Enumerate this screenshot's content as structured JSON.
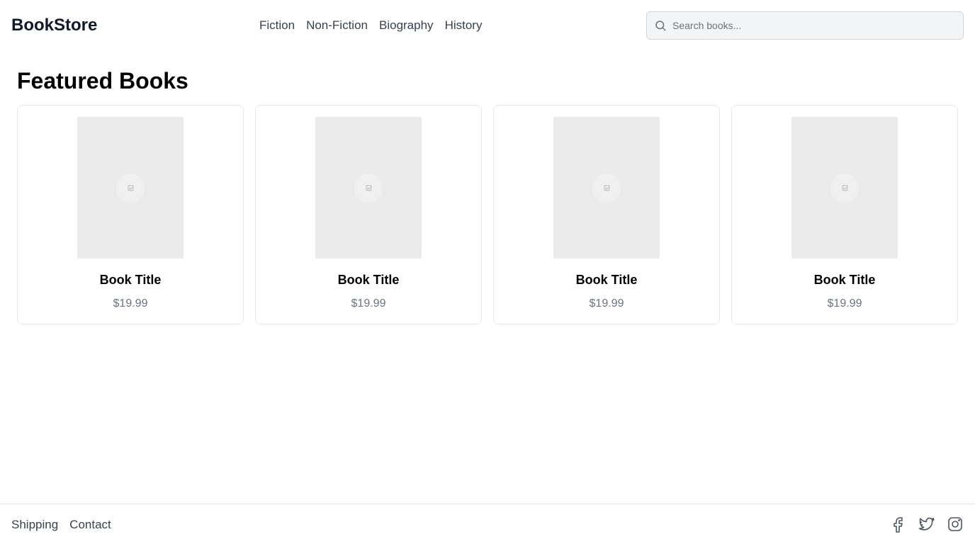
{
  "header": {
    "brand": "BookStore",
    "nav": [
      {
        "label": "Fiction"
      },
      {
        "label": "Non-Fiction"
      },
      {
        "label": "Biography"
      },
      {
        "label": "History"
      }
    ],
    "search": {
      "placeholder": "Search books...",
      "value": "",
      "icon": "search-icon"
    }
  },
  "main": {
    "section_title": "Featured Books",
    "books": [
      {
        "title": "Book Title",
        "price": "$19.99",
        "cover_icon": "image-placeholder-icon"
      },
      {
        "title": "Book Title",
        "price": "$19.99",
        "cover_icon": "image-placeholder-icon"
      },
      {
        "title": "Book Title",
        "price": "$19.99",
        "cover_icon": "image-placeholder-icon"
      },
      {
        "title": "Book Title",
        "price": "$19.99",
        "cover_icon": "image-placeholder-icon"
      }
    ]
  },
  "footer": {
    "links": [
      {
        "label": "Shipping"
      },
      {
        "label": "Contact"
      }
    ],
    "social": [
      {
        "icon": "facebook-icon"
      },
      {
        "icon": "twitter-icon"
      },
      {
        "icon": "instagram-icon"
      }
    ]
  },
  "colors": {
    "text": "#111827",
    "muted": "#6b7280",
    "border": "#e5e7eb",
    "cover_bg": "#ebebeb",
    "search_bg": "#f3f4f6"
  }
}
